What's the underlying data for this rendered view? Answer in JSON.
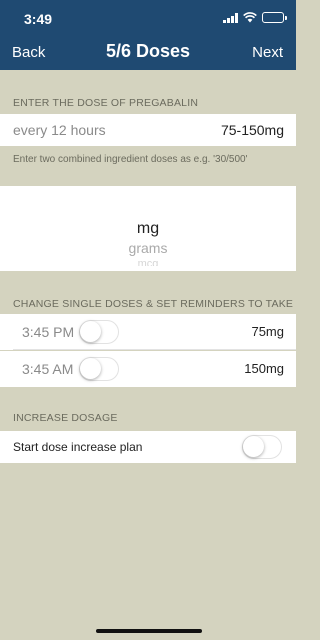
{
  "status_bar": {
    "time": "3:49"
  },
  "nav": {
    "back_label": "Back",
    "title": "5/6 Doses",
    "next_label": "Next"
  },
  "dose_section": {
    "header": "ENTER THE DOSE OF PREGABALIN",
    "frequency": "every 12 hours",
    "dose_range": "75-150mg",
    "hint": "Enter two combined ingredient doses as e.g. '30/500'"
  },
  "unit_picker": {
    "selected": "mg",
    "next": "grams",
    "far": "mcg"
  },
  "reminders_section": {
    "header": "CHANGE SINGLE DOSES & SET REMINDERS TO TAKE",
    "items": [
      {
        "time": "3:45 PM",
        "dose": "75mg",
        "enabled": false
      },
      {
        "time": "3:45 AM",
        "dose": "150mg",
        "enabled": false
      }
    ]
  },
  "increase_section": {
    "header": "INCREASE DOSAGE",
    "label": "Start dose increase plan",
    "enabled": false
  },
  "colors": {
    "header_bg": "#1f4a72",
    "page_bg": "#d4d3bf"
  }
}
